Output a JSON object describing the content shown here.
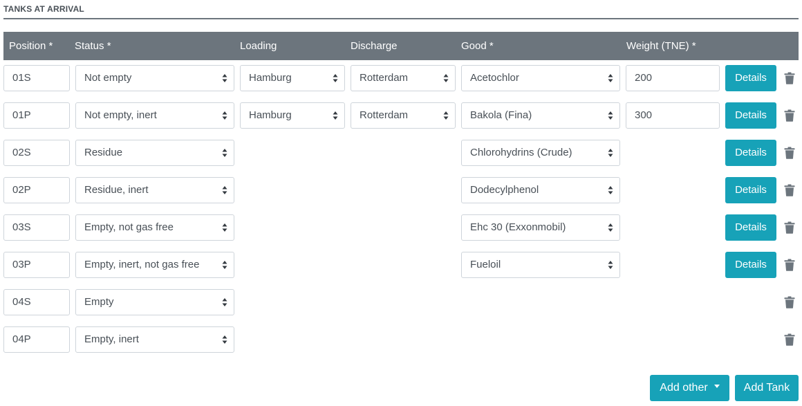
{
  "section": {
    "title": "TANKS AT ARRIVAL"
  },
  "columns": {
    "position": "Position *",
    "status": "Status *",
    "loading": "Loading",
    "discharge": "Discharge",
    "good": "Good *",
    "weight": "Weight (TNE) *"
  },
  "rows": [
    {
      "position": "01S",
      "status": "Not empty",
      "loading": "Hamburg",
      "discharge": "Rotterdam",
      "good": "Acetochlor",
      "weight": "200",
      "details": "Details"
    },
    {
      "position": "01P",
      "status": "Not empty, inert",
      "loading": "Hamburg",
      "discharge": "Rotterdam",
      "good": "Bakola (Fina)",
      "weight": "300",
      "details": "Details"
    },
    {
      "position": "02S",
      "status": "Residue",
      "good": "Chlorohydrins (Crude)",
      "details": "Details"
    },
    {
      "position": "02P",
      "status": "Residue, inert",
      "good": "Dodecylphenol",
      "details": "Details"
    },
    {
      "position": "03S",
      "status": "Empty, not gas free",
      "good": "Ehc 30 (Exxonmobil)",
      "details": "Details"
    },
    {
      "position": "03P",
      "status": "Empty, inert, not gas free",
      "good": "Fueloil",
      "details": "Details"
    },
    {
      "position": "04S",
      "status": "Empty"
    },
    {
      "position": "04P",
      "status": "Empty, inert"
    }
  ],
  "actions": {
    "add_other": "Add other",
    "add_tank": "Add Tank"
  },
  "icons": {
    "select": "select-caret-icon",
    "delete": "trash-icon",
    "dropdown": "caret-down-icon"
  },
  "colors": {
    "header_bg": "#6c757d",
    "accent": "#17a2b8",
    "border": "#ced4da",
    "icon": "#6c757d"
  }
}
